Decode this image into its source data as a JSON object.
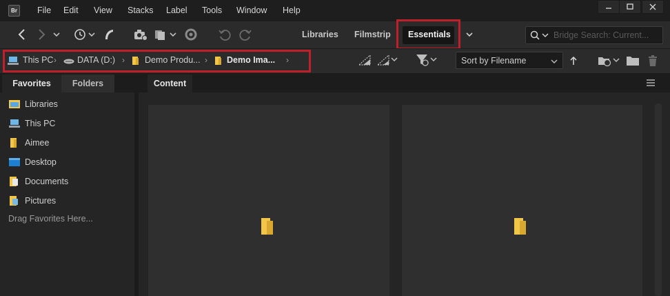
{
  "app": {
    "logo_text": "Br"
  },
  "menu": {
    "items": [
      "File",
      "Edit",
      "View",
      "Stacks",
      "Label",
      "Tools",
      "Window",
      "Help"
    ]
  },
  "workspaces": {
    "items": [
      "Libraries",
      "Filmstrip",
      "Essentials"
    ],
    "active": "Essentials"
  },
  "search": {
    "placeholder": "Bridge Search: Current..."
  },
  "path": {
    "crumbs": [
      "This PC",
      "DATA (D:)",
      "Demo Produ...",
      "Demo Ima..."
    ]
  },
  "sort": {
    "label": "Sort by Filename"
  },
  "left_panel": {
    "tabs": [
      "Favorites",
      "Folders"
    ],
    "favorites": [
      {
        "label": "Libraries",
        "icon": "libraries-folder-icon"
      },
      {
        "label": "This PC",
        "icon": "computer-icon"
      },
      {
        "label": "Aimee",
        "icon": "user-folder-icon"
      },
      {
        "label": "Desktop",
        "icon": "desktop-folder-icon"
      },
      {
        "label": "Documents",
        "icon": "documents-folder-icon"
      },
      {
        "label": "Pictures",
        "icon": "pictures-folder-icon"
      }
    ],
    "drag_hint": "Drag Favorites Here..."
  },
  "content": {
    "tab_label": "Content",
    "items": [
      {
        "icon": "folder-icon"
      },
      {
        "icon": "folder-icon"
      }
    ]
  },
  "colors": {
    "highlight": "#c0202c",
    "folder": "#f2c649",
    "background": "#1e1e1e",
    "panel": "#252525"
  }
}
